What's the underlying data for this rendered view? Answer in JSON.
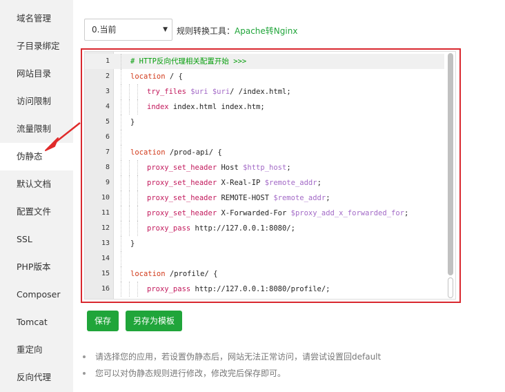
{
  "sidebar": {
    "items": [
      {
        "label": "域名管理",
        "active": false
      },
      {
        "label": "子目录绑定",
        "active": false
      },
      {
        "label": "网站目录",
        "active": false
      },
      {
        "label": "访问限制",
        "active": false
      },
      {
        "label": "流量限制",
        "active": false
      },
      {
        "label": "伪静态",
        "active": true
      },
      {
        "label": "默认文档",
        "active": false
      },
      {
        "label": "配置文件",
        "active": false
      },
      {
        "label": "SSL",
        "active": false
      },
      {
        "label": "PHP版本",
        "active": false
      },
      {
        "label": "Composer",
        "active": false
      },
      {
        "label": "Tomcat",
        "active": false
      },
      {
        "label": "重定向",
        "active": false
      },
      {
        "label": "反向代理",
        "active": false
      }
    ]
  },
  "toolbar": {
    "select_value": "0.当前",
    "tool_label": "规则转换工具：",
    "tool_link": "Apache转Nginx"
  },
  "editor": {
    "lines": [
      {
        "no": "1",
        "indent": 1,
        "tokens": [
          {
            "t": "# HTTP反向代理相关配置开始 >>>",
            "c": "comment"
          }
        ]
      },
      {
        "no": "2",
        "indent": 0,
        "tokens": [
          {
            "t": "location",
            "c": "kw"
          },
          {
            "t": " / {",
            "c": "plain"
          }
        ]
      },
      {
        "no": "3",
        "indent": 2,
        "tokens": [
          {
            "t": "try_files",
            "c": "dir"
          },
          {
            "t": " ",
            "c": "plain"
          },
          {
            "t": "$uri",
            "c": "var"
          },
          {
            "t": " ",
            "c": "plain"
          },
          {
            "t": "$uri",
            "c": "var"
          },
          {
            "t": "/ /index.html;",
            "c": "plain"
          }
        ]
      },
      {
        "no": "4",
        "indent": 2,
        "tokens": [
          {
            "t": "index",
            "c": "dir"
          },
          {
            "t": " index.html index.htm;",
            "c": "plain"
          }
        ]
      },
      {
        "no": "5",
        "indent": 0,
        "tokens": [
          {
            "t": "}",
            "c": "plain"
          }
        ]
      },
      {
        "no": "6",
        "indent": 0,
        "tokens": []
      },
      {
        "no": "7",
        "indent": 0,
        "tokens": [
          {
            "t": "location",
            "c": "kw"
          },
          {
            "t": " /prod-api/ {",
            "c": "plain"
          }
        ]
      },
      {
        "no": "8",
        "indent": 2,
        "tokens": [
          {
            "t": "proxy_set_header",
            "c": "dir"
          },
          {
            "t": " Host ",
            "c": "plain"
          },
          {
            "t": "$http_host",
            "c": "var"
          },
          {
            "t": ";",
            "c": "plain"
          }
        ]
      },
      {
        "no": "9",
        "indent": 2,
        "tokens": [
          {
            "t": "proxy_set_header",
            "c": "dir"
          },
          {
            "t": " X-Real-IP ",
            "c": "plain"
          },
          {
            "t": "$remote_addr",
            "c": "var"
          },
          {
            "t": ";",
            "c": "plain"
          }
        ]
      },
      {
        "no": "10",
        "indent": 2,
        "tokens": [
          {
            "t": "proxy_set_header",
            "c": "dir"
          },
          {
            "t": " REMOTE-HOST ",
            "c": "plain"
          },
          {
            "t": "$remote_addr",
            "c": "var"
          },
          {
            "t": ";",
            "c": "plain"
          }
        ]
      },
      {
        "no": "11",
        "indent": 2,
        "tokens": [
          {
            "t": "proxy_set_header",
            "c": "dir"
          },
          {
            "t": " X-Forwarded-For ",
            "c": "plain"
          },
          {
            "t": "$proxy_add_x_forwarded_for",
            "c": "var"
          },
          {
            "t": ";",
            "c": "plain"
          }
        ]
      },
      {
        "no": "12",
        "indent": 2,
        "tokens": [
          {
            "t": "proxy_pass",
            "c": "dir"
          },
          {
            "t": " http://127.0.0.1:8080/;",
            "c": "plain"
          }
        ]
      },
      {
        "no": "13",
        "indent": 0,
        "tokens": [
          {
            "t": "}",
            "c": "plain"
          }
        ]
      },
      {
        "no": "14",
        "indent": 0,
        "tokens": []
      },
      {
        "no": "15",
        "indent": 0,
        "tokens": [
          {
            "t": "location",
            "c": "kw"
          },
          {
            "t": " /profile/ {",
            "c": "plain"
          }
        ]
      },
      {
        "no": "16",
        "indent": 2,
        "tokens": [
          {
            "t": "proxy_pass",
            "c": "dir"
          },
          {
            "t": " http://127.0.0.1:8080/profile/;",
            "c": "plain"
          }
        ]
      }
    ]
  },
  "buttons": {
    "save": "保存",
    "save_as_template": "另存为模板"
  },
  "tips": [
    "请选择您的应用，若设置伪静态后，网站无法正常访问，请尝试设置回default",
    "您可以对伪静态规则进行修改，修改完后保存即可。"
  ],
  "colors": {
    "accent": "#20a53a",
    "highlight_border": "#d9272e",
    "annotation_arrow": "#e02a2a"
  }
}
